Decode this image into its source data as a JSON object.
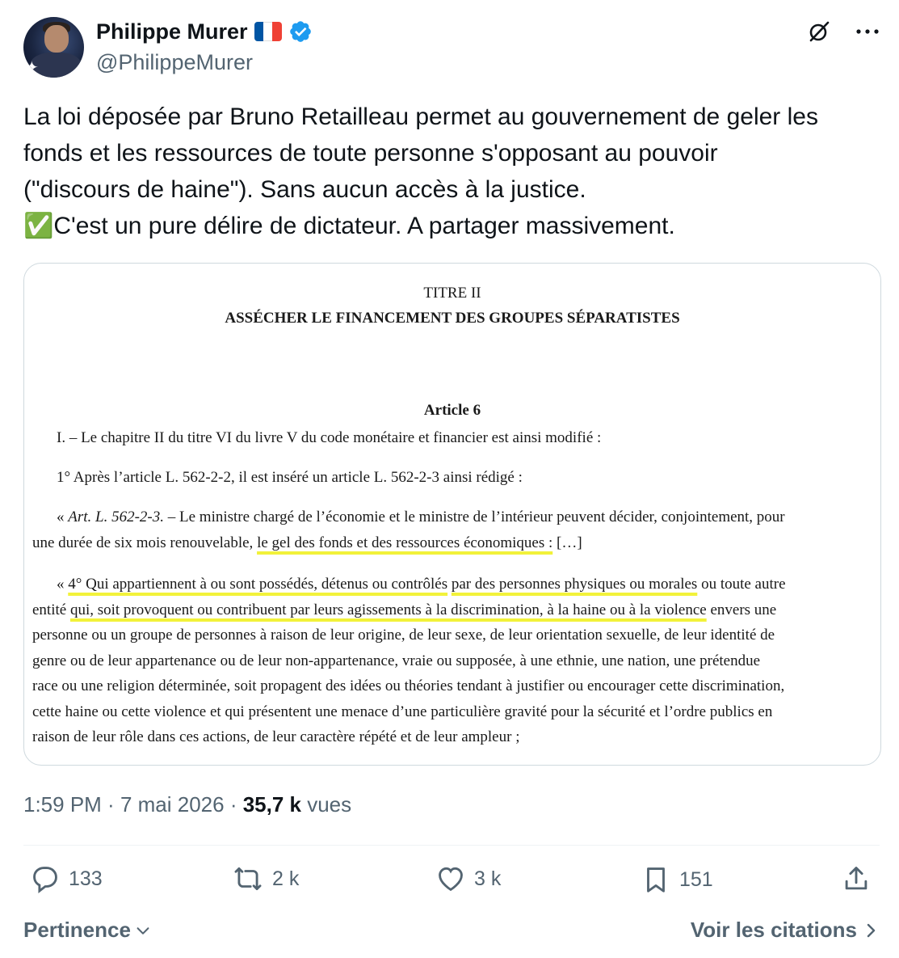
{
  "author": {
    "display_name": "Philippe Murer",
    "handle": "@PhilippeMurer",
    "flag_colors": [
      "#0055a4",
      "#ffffff",
      "#ef4135"
    ],
    "verified_color": "#1d9bf0"
  },
  "tweet": {
    "text": "La loi déposée par Bruno Retailleau permet au gouvernement de geler les\nfonds et les ressources de toute personne s'opposant au pouvoir\n(\"discours de haine\"). Sans aucun accès à la justice.\n✅C'est un pure délire de dictateur. A partager massivement."
  },
  "document": {
    "titre": "TITRE II",
    "heading": "ASSÉCHER LE FINANCEMENT DES GROUPES SÉPARATISTES",
    "article": "Article 6",
    "p1": "I. – Le chapitre II du titre VI du livre V du code monétaire et financier est ainsi modifié :",
    "p2": "1° Après l’article L. 562-2-2, il est inséré un article L. 562-2-3 ainsi rédigé :",
    "p3_prefix": "« ",
    "p3_italic": "Art. L. 562-2-3.",
    "p3_rest": " – Le ministre chargé de l’économie et le ministre de l’intérieur peuvent décider, conjointement, pour",
    "p3_line2_pre": "une durée de six mois renouvelable, ",
    "p3_line2_hl": "le gel des fonds et des ressources économiques :",
    "p3_line2_post": " […]",
    "p4_l1_pre": "« ",
    "p4_l1_hl1": "4° Qui appartiennent à ou sont possédés, détenus ou contrôlés",
    "p4_l1_mid": " ",
    "p4_l1_hl2": "par des personnes physiques ou morales",
    "p4_l1_post": " ou toute autre",
    "p4_l2_pre": "entité ",
    "p4_l2_hl": "qui, soit provoquent ou contribuent par leurs agissements à la discrimination, à la haine ou à la violence",
    "p4_l2_post": " envers une",
    "p4_l3": "personne ou un groupe de personnes à raison de leur origine, de leur sexe, de leur orientation sexuelle, de leur identité de",
    "p4_l4": "genre ou de leur appartenance ou de leur non-appartenance, vraie ou supposée, à une ethnie, une nation, une prétendue",
    "p4_l5": "race ou une religion déterminée, soit propagent des idées ou théories tendant à justifier ou encourager cette discrimination,",
    "p4_l6": "cette haine ou cette violence et qui présentent une menace d’une particulière gravité pour la sécurité et l’ordre publics en",
    "p4_l7": "raison de leur rôle dans ces actions, de leur caractère répété et de leur ampleur ;"
  },
  "meta": {
    "time": "1:59 PM",
    "sep1": " · ",
    "date": "7 mai 2026",
    "sep2": " · ",
    "views_count": "35,7 k",
    "views_label": " vues"
  },
  "actions": {
    "replies": "133",
    "reposts": "2 k",
    "likes": "3 k",
    "bookmarks": "151"
  },
  "footer": {
    "sort_label": "Pertinence",
    "quotes_link": "Voir les citations"
  },
  "colors": {
    "secondary_text": "#536471",
    "highlight": "#f2f23a",
    "border": "#cfd9de"
  }
}
